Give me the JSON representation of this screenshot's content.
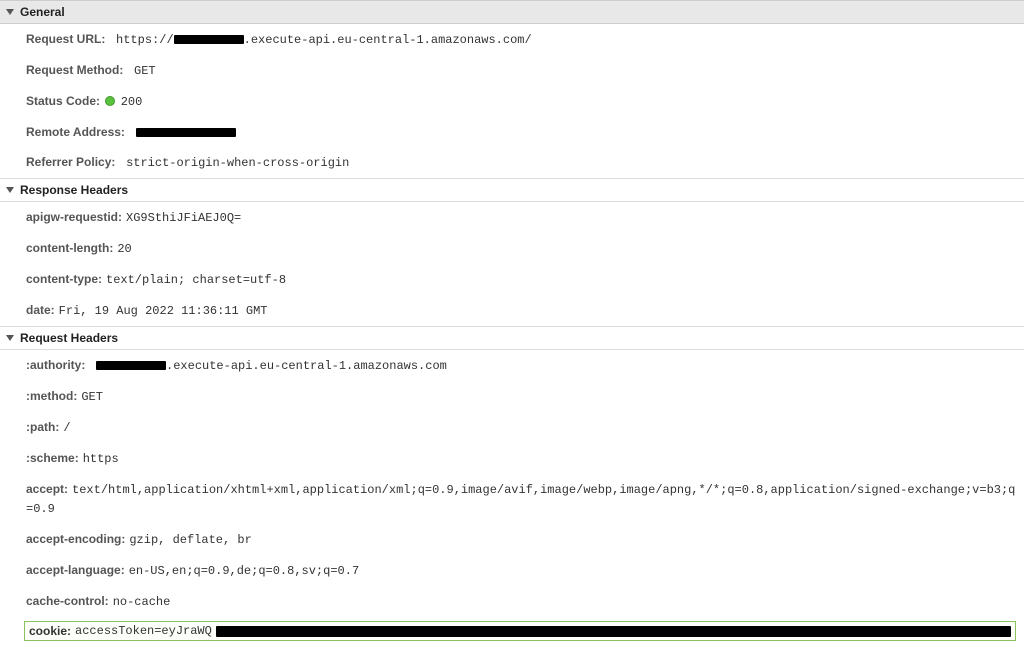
{
  "general": {
    "title": "General",
    "requestUrl": {
      "label": "Request URL:",
      "prefix": "https://",
      "suffix": ".execute-api.eu-central-1.amazonaws.com/"
    },
    "requestMethod": {
      "label": "Request Method:",
      "value": "GET"
    },
    "statusCode": {
      "label": "Status Code:",
      "value": "200"
    },
    "remoteAddress": {
      "label": "Remote Address:"
    },
    "referrerPolicy": {
      "label": "Referrer Policy:",
      "value": "strict-origin-when-cross-origin"
    }
  },
  "responseHeaders": {
    "title": "Response Headers",
    "items": [
      {
        "label": "apigw-requestid:",
        "value": "XG9SthiJFiAEJ0Q="
      },
      {
        "label": "content-length:",
        "value": "20"
      },
      {
        "label": "content-type:",
        "value": "text/plain; charset=utf-8"
      },
      {
        "label": "date:",
        "value": "Fri, 19 Aug 2022 11:36:11 GMT"
      }
    ]
  },
  "requestHeaders": {
    "title": "Request Headers",
    "authority": {
      "label": ":authority:",
      "suffix": ".execute-api.eu-central-1.amazonaws.com"
    },
    "items": [
      {
        "label": ":method:",
        "value": "GET"
      },
      {
        "label": ":path:",
        "value": "/"
      },
      {
        "label": ":scheme:",
        "value": "https"
      },
      {
        "label": "accept:",
        "value": "text/html,application/xhtml+xml,application/xml;q=0.9,image/avif,image/webp,image/apng,*/*;q=0.8,application/signed-exchange;v=b3;q=0.9"
      },
      {
        "label": "accept-encoding:",
        "value": "gzip, deflate, br"
      },
      {
        "label": "accept-language:",
        "value": "en-US,en;q=0.9,de;q=0.8,sv;q=0.7"
      },
      {
        "label": "cache-control:",
        "value": "no-cache"
      }
    ],
    "cookie": {
      "label": "cookie:",
      "prefix": "accessToken=eyJraWQ"
    }
  }
}
